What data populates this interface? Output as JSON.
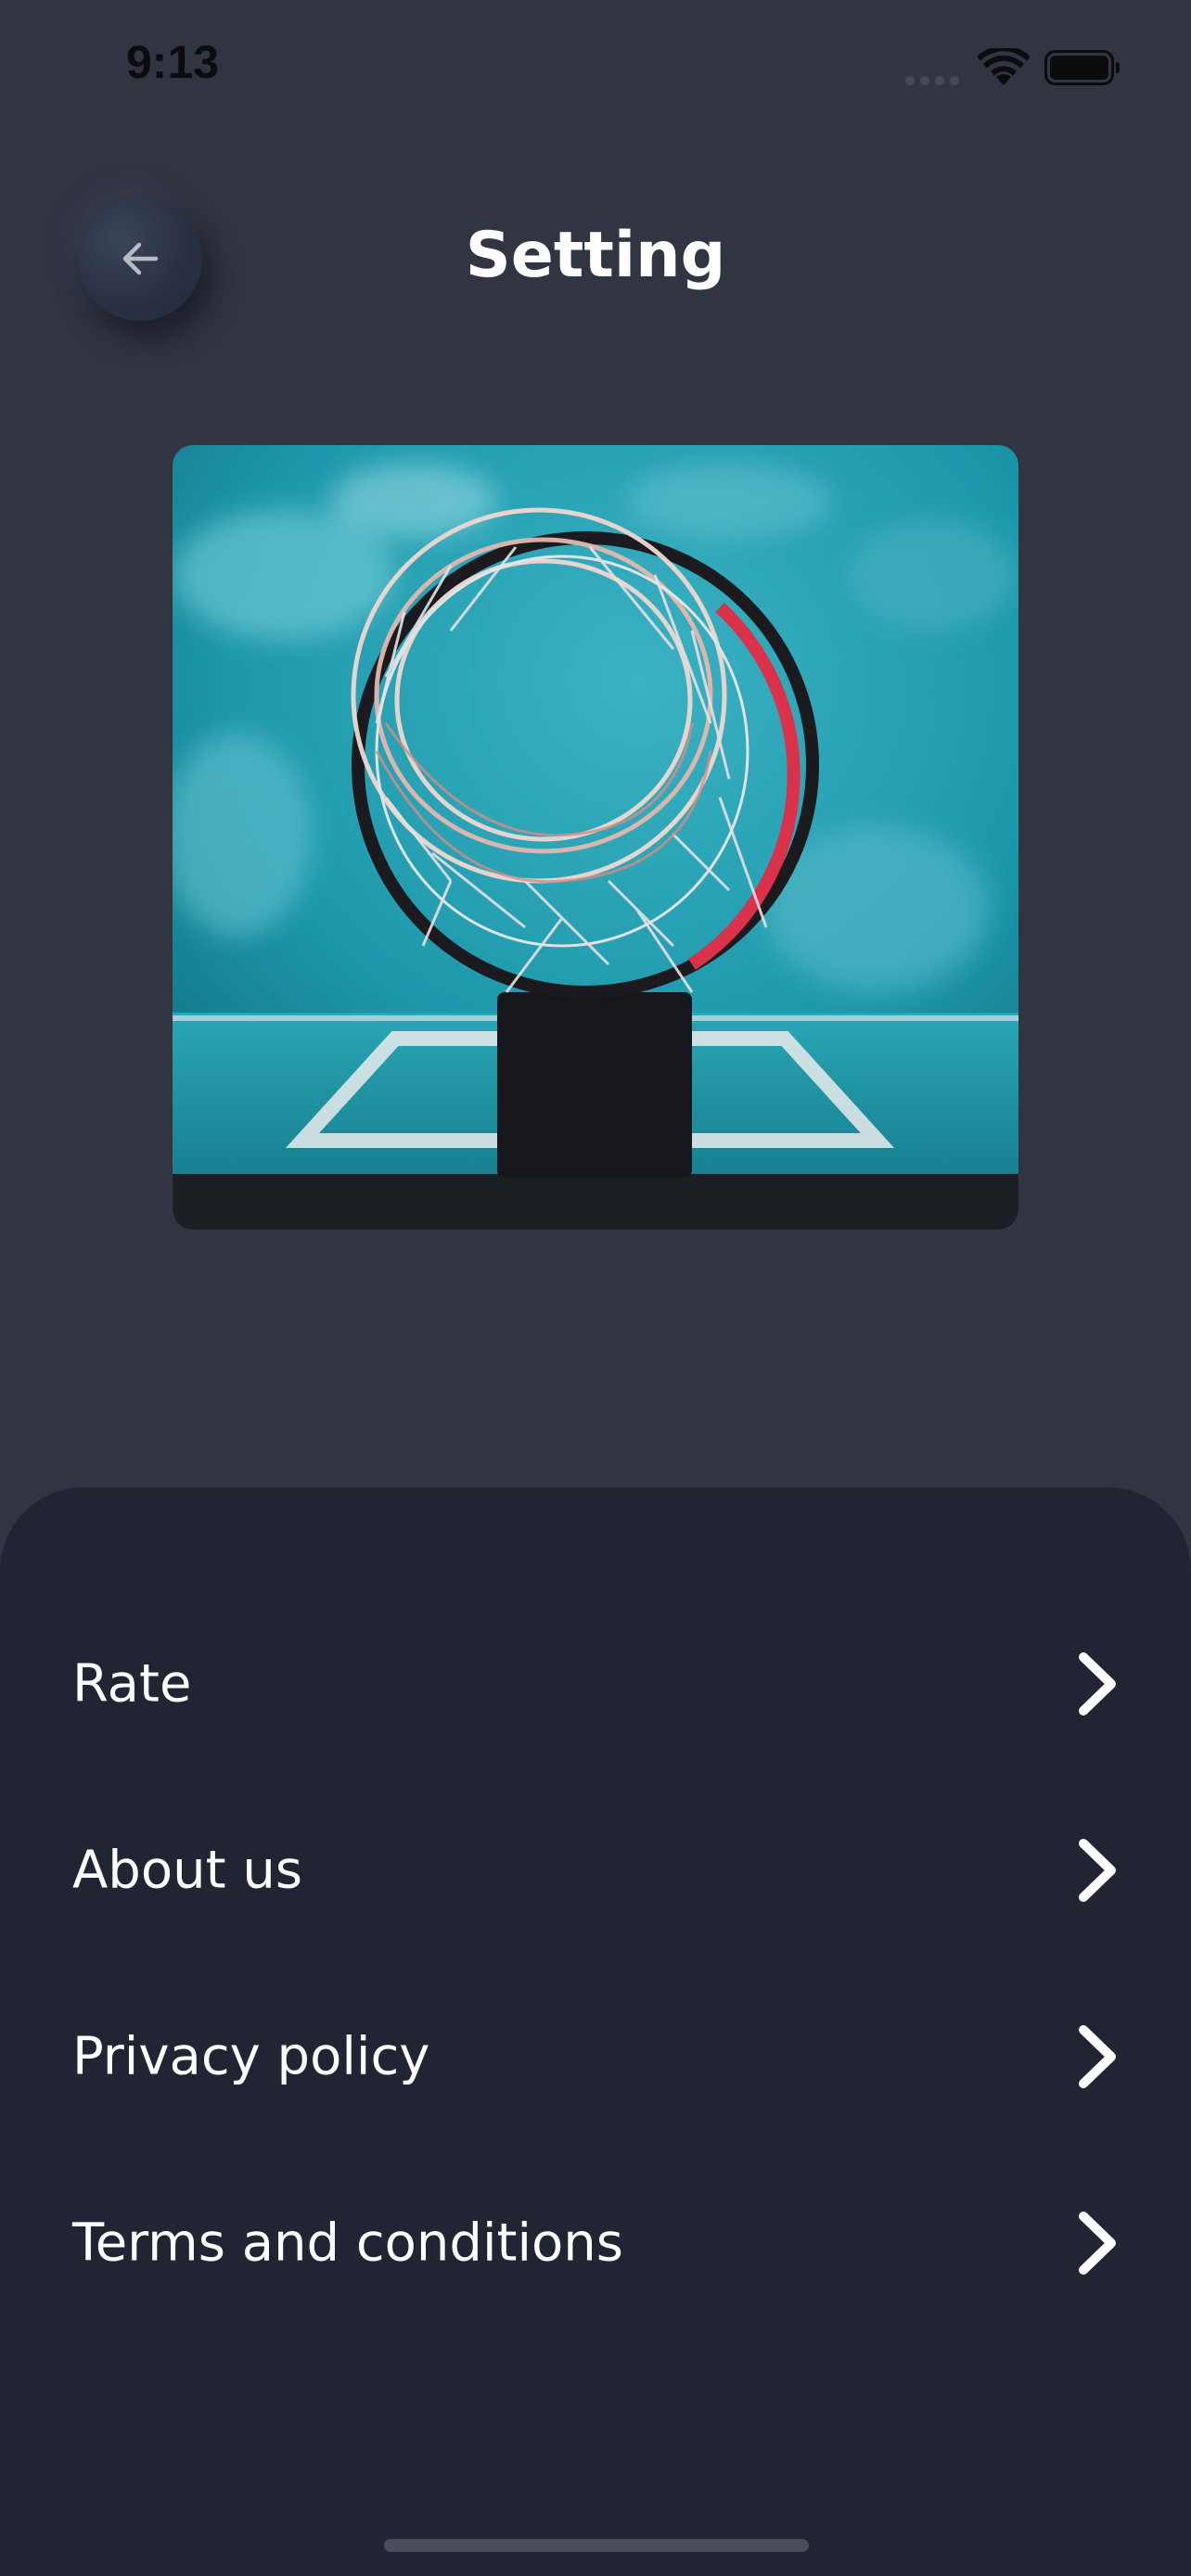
{
  "status_bar": {
    "time": "9:13"
  },
  "header": {
    "title": "Setting",
    "back_icon": "arrow-left-icon"
  },
  "hero": {
    "description": "basketball-hoop-photo"
  },
  "menu": {
    "items": [
      {
        "label": "Rate",
        "icon": "chevron-right-icon"
      },
      {
        "label": "About us",
        "icon": "chevron-right-icon"
      },
      {
        "label": "Privacy policy",
        "icon": "chevron-right-icon"
      },
      {
        "label": "Terms and conditions",
        "icon": "chevron-right-icon"
      }
    ]
  },
  "colors": {
    "background": "#313441",
    "sheet": "#212432",
    "text": "#ffffff",
    "accent_hoop": "#d9324a",
    "backboard": "#1e9bab"
  }
}
